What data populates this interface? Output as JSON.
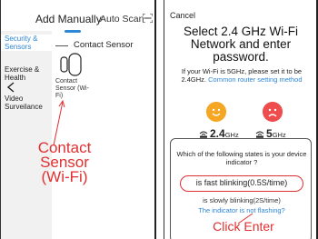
{
  "left_screen": {
    "title": "Add Manually",
    "auto_scan_label": "Auto Scan",
    "sidebar": {
      "items": [
        {
          "label": "Security & Sensors",
          "active": true
        },
        {
          "label": "Exercise & Health",
          "active": false
        },
        {
          "label": "Video Surveilance",
          "active": false
        }
      ]
    },
    "section_label": "Contact Sensor",
    "device": {
      "label": "Contact Sensor (Wi-Fi)",
      "icon": "contact-sensor-icon"
    },
    "callout": "Contact Sensor (Wi-Fi)"
  },
  "right_screen": {
    "cancel_label": "Cancel",
    "title": "Select 2.4 GHz Wi-Fi Network and enter password.",
    "note": "If your Wi-Fi is 5GHz, please set it to be 2.4GHz.",
    "note_link": "Common router setting method",
    "bands": [
      {
        "value": "2.4",
        "unit": "GHz",
        "status": "ok"
      },
      {
        "value": "5",
        "unit": "GHz",
        "status": "bad"
      }
    ],
    "card": {
      "question": "Which of the following states is your device indicator ?",
      "option_fast": "is fast blinking(0.5S/time)",
      "option_slow": "is slowly blinking(2S/time)",
      "option_none": "The indicator is not flashing?",
      "callout": "Click Enter"
    }
  },
  "colors": {
    "accent": "#2f86d6",
    "highlight": "#e03030",
    "ok": "#f5a623",
    "bad": "#ef4d4d"
  }
}
